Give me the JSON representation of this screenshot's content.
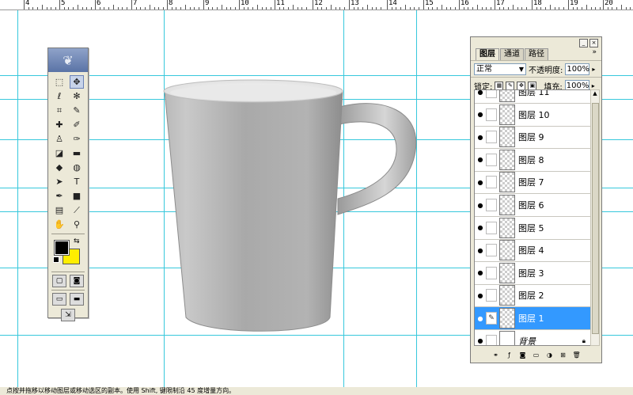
{
  "ruler": {
    "numbers": [
      "4",
      "5",
      "6",
      "7",
      "8",
      "9",
      "10",
      "11",
      "12",
      "13",
      "14",
      "15",
      "16",
      "17",
      "18",
      "19",
      "20"
    ]
  },
  "toolbox": {
    "logo": "feather-logo",
    "tools": [
      {
        "name": "marquee-tool-icon",
        "glyph": "⬚"
      },
      {
        "name": "move-tool-icon",
        "glyph": "✥",
        "selected": true
      },
      {
        "name": "lasso-tool-icon",
        "glyph": "ℓ"
      },
      {
        "name": "magic-wand-tool-icon",
        "glyph": "✻"
      },
      {
        "name": "crop-tool-icon",
        "glyph": "⌗"
      },
      {
        "name": "slice-tool-icon",
        "glyph": "✎"
      },
      {
        "name": "healing-brush-tool-icon",
        "glyph": "✚"
      },
      {
        "name": "brush-tool-icon",
        "glyph": "✐"
      },
      {
        "name": "stamp-tool-icon",
        "glyph": "♙"
      },
      {
        "name": "history-brush-tool-icon",
        "glyph": "✑"
      },
      {
        "name": "eraser-tool-icon",
        "glyph": "◪"
      },
      {
        "name": "gradient-tool-icon",
        "glyph": "▬"
      },
      {
        "name": "blur-tool-icon",
        "glyph": "◆"
      },
      {
        "name": "dodge-tool-icon",
        "glyph": "◍"
      },
      {
        "name": "path-selection-tool-icon",
        "glyph": "➤"
      },
      {
        "name": "type-tool-icon",
        "glyph": "T"
      },
      {
        "name": "pen-tool-icon",
        "glyph": "✒"
      },
      {
        "name": "shape-tool-icon",
        "glyph": "■"
      },
      {
        "name": "notes-tool-icon",
        "glyph": "▤"
      },
      {
        "name": "eyedropper-tool-icon",
        "glyph": "⟋"
      },
      {
        "name": "hand-tool-icon",
        "glyph": "✋"
      },
      {
        "name": "zoom-tool-icon",
        "glyph": "⚲"
      }
    ],
    "foreground_color": "#000000",
    "background_color": "#ffee00"
  },
  "layers_panel": {
    "tabs": [
      "图层",
      "通道",
      "路径"
    ],
    "blend_mode": "正常",
    "opacity_label": "不透明度:",
    "opacity_value": "100%",
    "lock_label": "锁定:",
    "fill_label": "填充:",
    "fill_value": "100%",
    "layers": [
      {
        "name": "图层 11",
        "selected": false
      },
      {
        "name": "图层 10",
        "selected": false
      },
      {
        "name": "图层 9",
        "selected": false
      },
      {
        "name": "图层 8",
        "selected": false
      },
      {
        "name": "图层 7",
        "selected": false
      },
      {
        "name": "图层 6",
        "selected": false
      },
      {
        "name": "图层 5",
        "selected": false
      },
      {
        "name": "图层 4",
        "selected": false
      },
      {
        "name": "图层 3",
        "selected": false
      },
      {
        "name": "图层 2",
        "selected": false
      },
      {
        "name": "图层 1",
        "selected": true
      },
      {
        "name": "背景",
        "selected": false,
        "background": true
      }
    ],
    "bottom_icons": [
      "link-layers-icon",
      "layer-style-icon",
      "layer-mask-icon",
      "new-set-icon",
      "adjustment-layer-icon",
      "new-layer-icon",
      "delete-layer-icon"
    ]
  },
  "status_text": "点按并拖移以移动图层或移动选区的副本。使用 Shift, 键限制沿 45 度增量方向。",
  "accent_color": "#3399ff",
  "guide_color": "#37c8dc"
}
